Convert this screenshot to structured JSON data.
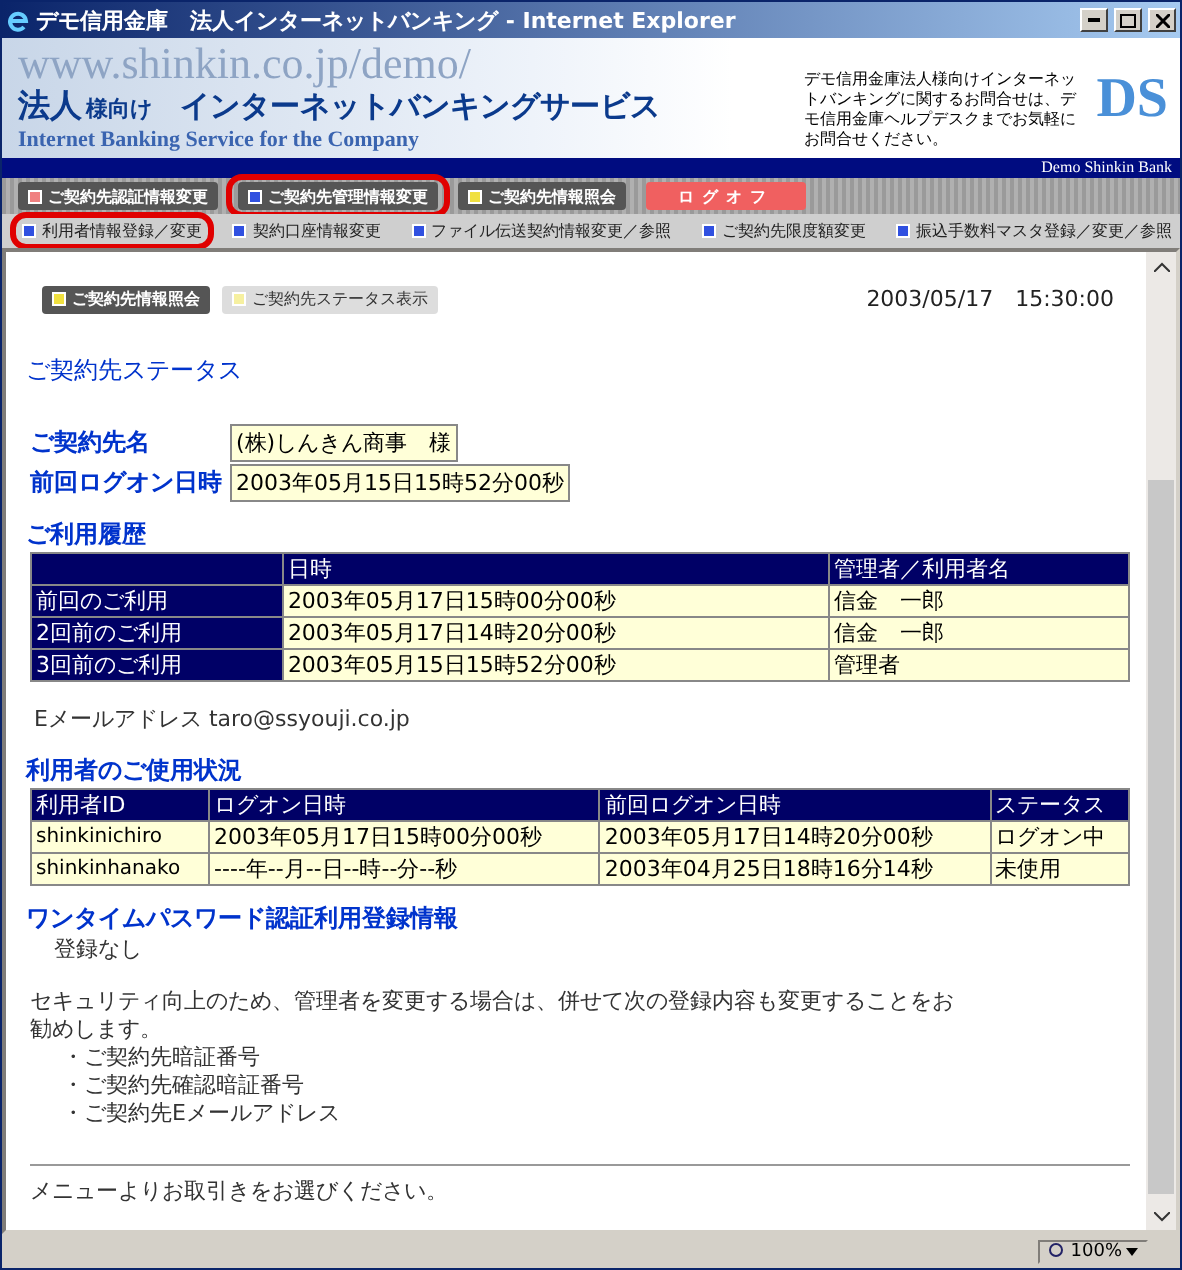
{
  "window": {
    "title": "デモ信用金庫　法人インターネットバンキング - Internet Explorer"
  },
  "banner": {
    "url_art": "www.shinkin.co.jp/demo/",
    "title_main": "法人",
    "title_small": "様向け",
    "title_rest": "インターネットバンキングサービス",
    "subtitle": "Internet Banking Service for the Company",
    "notice": "デモ信用金庫法人様向けインターネットバンキングに関するお問合せは、デモ信用金庫ヘルプデスクまでお気軽にお問合せください。",
    "logo": "DS",
    "bank_name": "Demo Shinkin Bank"
  },
  "main_menu": [
    {
      "label": "ご契約先認証情報変更",
      "kind": "pink",
      "highlighted": false
    },
    {
      "label": "ご契約先管理情報変更",
      "kind": "blue",
      "highlighted": true
    },
    {
      "label": "ご契約先情報照会",
      "kind": "yellow",
      "highlighted": false
    },
    {
      "label": "ログオフ",
      "kind": "logoff",
      "highlighted": false
    }
  ],
  "sub_menu": [
    {
      "label": "利用者情報登録／変更",
      "highlighted": true
    },
    {
      "label": "契約口座情報変更",
      "highlighted": false
    },
    {
      "label": "ファイル伝送契約情報変更／参照",
      "highlighted": false
    },
    {
      "label": "ご契約先限度額変更",
      "highlighted": false
    },
    {
      "label": "振込手数料マスタ登録／変更／参照",
      "highlighted": false
    }
  ],
  "page_tabs": [
    {
      "label": "ご契約先情報照会",
      "selected": true
    },
    {
      "label": "ご契約先ステータス表示",
      "selected": false
    }
  ],
  "datetime": "2003/05/17　15:30:00",
  "page_title": "ご契約先ステータス",
  "contract": [
    {
      "label": "ご契約先名",
      "value": "(株)しんきん商事　様"
    },
    {
      "label": "前回ログオン日時",
      "value": "2003年05月15日15時52分00秒"
    }
  ],
  "history": {
    "title": "ご利用履歴",
    "columns": [
      "",
      "日時",
      "管理者／利用者名"
    ],
    "rows": [
      [
        "前回のご利用",
        "2003年05月17日15時00分00秒",
        "信金　一郎"
      ],
      [
        "2回前のご利用",
        "2003年05月17日14時20分00秒",
        "信金　一郎"
      ],
      [
        "3回前のご利用",
        "2003年05月15日15時52分00秒",
        "管理者"
      ]
    ]
  },
  "email": {
    "label": "Eメールアドレス",
    "value": "taro@ssyouji.co.jp"
  },
  "usage": {
    "title": "利用者のご使用状況",
    "columns": [
      "利用者ID",
      "ログオン日時",
      "前回ログオン日時",
      "ステータス"
    ],
    "rows": [
      [
        "shinkinichiro",
        "2003年05月17日15時00分00秒",
        "2003年05月17日14時20分00秒",
        "ログオン中"
      ],
      [
        "shinkinhanako",
        "----年--月--日--時--分--秒",
        "2003年04月25日18時16分14秒",
        "未使用"
      ]
    ]
  },
  "otp": {
    "title": "ワンタイムパスワード認証利用登録情報",
    "value": "登録なし"
  },
  "notice": "セキュリティ向上のため、管理者を変更する場合は、併せて次の登録内容も変更することをお勧めします。",
  "bullets": [
    "・ご契約先暗証番号",
    "・ご契約先確認暗証番号",
    "・ご契約先Eメールアドレス"
  ],
  "footer_message": "メニューよりお取引きをお選びください。",
  "status_bar": {
    "zoom": "100%"
  }
}
